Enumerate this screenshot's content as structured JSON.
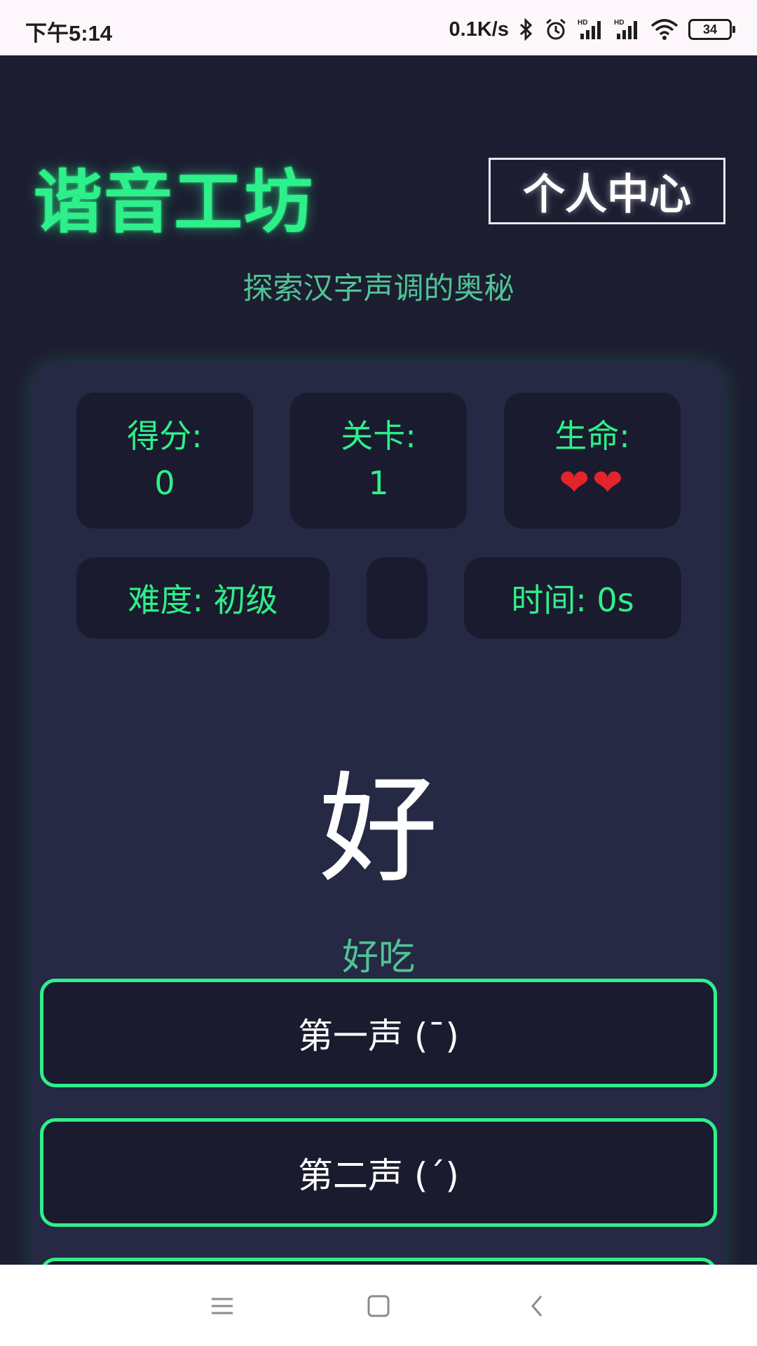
{
  "status_bar": {
    "time": "下午5:14",
    "network_speed": "0.1K/s",
    "battery_level": "34",
    "icons": [
      "bluetooth-icon",
      "alarm-icon",
      "signal-hd-icon",
      "signal-hd-icon",
      "wifi-icon",
      "battery-icon"
    ]
  },
  "header": {
    "app_title": "谐音工坊",
    "profile_button": "个人中心",
    "subtitle": "探索汉字声调的奥秘"
  },
  "stats": {
    "score_label": "得分:",
    "score_value": "0",
    "level_label": "关卡:",
    "level_value": "1",
    "lives_label": "生命:",
    "lives_value": "❤❤",
    "lives_count": 2,
    "difficulty_text": "难度: 初级",
    "time_text": "时间: 0s"
  },
  "question": {
    "character": "好",
    "word": "好吃"
  },
  "tone_options": [
    {
      "label": "第一声 (ˉ)"
    },
    {
      "label": "第二声 (ˊ)"
    },
    {
      "label": ""
    }
  ],
  "colors": {
    "accent": "#2ef08a",
    "background": "#1c1d31",
    "panel": "#252944",
    "box": "#1a1b2e",
    "subtitle": "#51c395",
    "heart": "#e2252b"
  },
  "nav_bar": {
    "icons": [
      "menu-icon",
      "home-icon",
      "back-icon"
    ]
  }
}
